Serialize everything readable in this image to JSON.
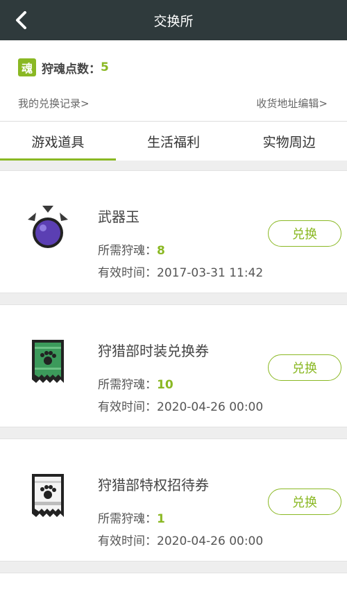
{
  "header": {
    "title": "交换所",
    "back_icon": "chevron-left-icon"
  },
  "points": {
    "badge": "魂",
    "label": "狩魂点数：",
    "value": "5"
  },
  "links": {
    "history": "我的兑换记录>",
    "address": "收货地址编辑>"
  },
  "tabs": [
    {
      "label": "游戏道具",
      "active": true
    },
    {
      "label": "生活福利",
      "active": false
    },
    {
      "label": "实物周边",
      "active": false
    }
  ],
  "items": [
    {
      "name": "武器玉",
      "cost_label": "所需狩魂：",
      "cost": "8",
      "valid_label": "有效时间：",
      "valid_time": "2017-03-31 11:42",
      "button": "兑换",
      "icon": "purple-gem-icon"
    },
    {
      "name": "狩猎部时装兑换券",
      "cost_label": "所需狩魂：",
      "cost": "10",
      "valid_label": "有效时间：",
      "valid_time": "2020-04-26 00:00",
      "button": "兑换",
      "icon": "green-paw-ticket-icon"
    },
    {
      "name": "狩猎部特权招待券",
      "cost_label": "所需狩魂：",
      "cost": "1",
      "valid_label": "有效时间：",
      "valid_time": "2020-04-26 00:00",
      "button": "兑换",
      "icon": "white-paw-ticket-icon"
    }
  ],
  "colors": {
    "accent": "#8ab823",
    "header_bg": "#2f3a3c"
  }
}
